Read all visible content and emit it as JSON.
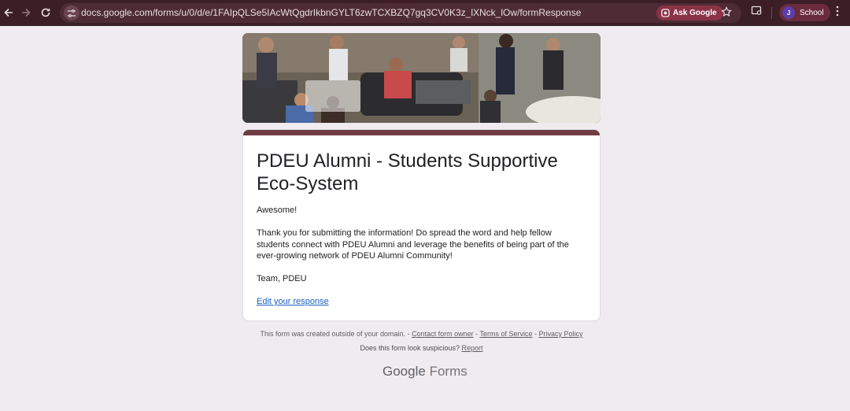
{
  "browser": {
    "url": "docs.google.com/forms/u/0/d/e/1FAIpQLSe5IAcWtQgdrIkbnGYLT6zwTCXBZQ7gq3CV0K3z_lXNck_lOw/formResponse",
    "ask_google_label": "Ask Google",
    "profile_initial": "J",
    "profile_name": "School"
  },
  "form": {
    "title": "PDEU Alumni - Students Supportive Eco-System",
    "greeting": "Awesome!",
    "message": "Thank you for submitting the information! Do spread the word and help fellow students connect with PDEU Alumni and leverage the benefits of being part of the ever-growing network of PDEU Alumni Community!",
    "signoff": "Team, PDEU",
    "edit_link": "Edit your response"
  },
  "footer": {
    "created_outside": "This form was created outside of your domain. -",
    "contact_owner": "Contact form owner",
    "sep1": "-",
    "terms": "Terms of Service",
    "sep2": "-",
    "privacy": "Privacy Policy",
    "suspicious": "Does this form look suspicious?",
    "report": "Report",
    "brand_google": "Google",
    "brand_forms": "Forms"
  },
  "colors": {
    "chrome_bg": "#3b1e26",
    "form_accent": "#703c43",
    "page_bg": "#efebee",
    "link": "#1a5fc0"
  }
}
